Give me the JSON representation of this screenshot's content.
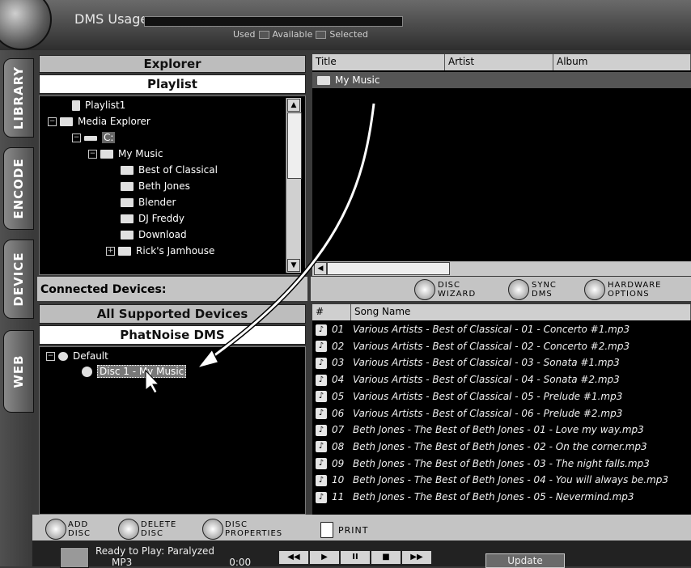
{
  "topbar": {
    "usage_label": "DMS Usage",
    "legend_used": "Used",
    "legend_available": "Available",
    "legend_selected": "Selected"
  },
  "tabs": [
    "LIBRARY",
    "ENCODE",
    "DEVICE",
    "WEB"
  ],
  "explorer": {
    "header": "Explorer",
    "subheader": "Playlist",
    "tree": [
      {
        "label": "Playlist1"
      },
      {
        "label": "Media Explorer"
      },
      {
        "label": "C:"
      },
      {
        "label": "My Music"
      },
      {
        "label": "Best of Classical"
      },
      {
        "label": "Beth Jones"
      },
      {
        "label": "Blender"
      },
      {
        "label": "DJ Freddy"
      },
      {
        "label": "Download"
      },
      {
        "label": "Rick's Jamhouse"
      }
    ]
  },
  "library": {
    "columns": [
      "Title",
      "Artist",
      "Album"
    ],
    "rows": [
      {
        "title": "My Music"
      }
    ]
  },
  "devices": {
    "label": "Connected Devices:",
    "header": "All Supported Devices",
    "subheader": "PhatNoise DMS",
    "root": "Default",
    "disc": "Disc 1 - My Music"
  },
  "toolbar": {
    "disc_wizard_1": "DISC",
    "disc_wizard_2": "WIZARD",
    "sync_1": "SYNC",
    "sync_2": "DMS",
    "hw_1": "HARDWARE",
    "hw_2": "OPTIONS"
  },
  "songs": {
    "columns": [
      "#",
      "Song Name"
    ],
    "rows": [
      {
        "num": "01",
        "name": "Various Artists - Best of Classical - 01 - Concerto #1.mp3"
      },
      {
        "num": "02",
        "name": "Various Artists - Best of Classical - 02 - Concerto #2.mp3"
      },
      {
        "num": "03",
        "name": "Various Artists - Best of Classical - 03 - Sonata #1.mp3"
      },
      {
        "num": "04",
        "name": "Various Artists - Best of Classical - 04 - Sonata #2.mp3"
      },
      {
        "num": "05",
        "name": "Various Artists - Best of Classical - 05 - Prelude #1.mp3"
      },
      {
        "num": "06",
        "name": "Various Artists - Best of Classical - 06 - Prelude #2.mp3"
      },
      {
        "num": "07",
        "name": "Beth Jones - The Best of Beth Jones - 01 - Love my way.mp3"
      },
      {
        "num": "08",
        "name": "Beth Jones - The Best of Beth Jones - 02 - On the corner.mp3"
      },
      {
        "num": "09",
        "name": "Beth Jones - The Best of Beth Jones - 03 - The night falls.mp3"
      },
      {
        "num": "10",
        "name": "Beth Jones - The Best of Beth Jones - 04 - You will always be.mp3"
      },
      {
        "num": "11",
        "name": "Beth Jones - The Best of Beth Jones - 05 - Nevermind.mp3"
      }
    ]
  },
  "disc_actions": {
    "add_1": "ADD",
    "add_2": "DISC",
    "delete_1": "DELETE",
    "delete_2": "DISC",
    "props_1": "DISC",
    "props_2": "PROPERTIES",
    "print": "PRINT"
  },
  "player": {
    "status": "Ready to Play: Paralyzed",
    "format": "MP3",
    "time": "0:00",
    "update_label": "Update"
  }
}
